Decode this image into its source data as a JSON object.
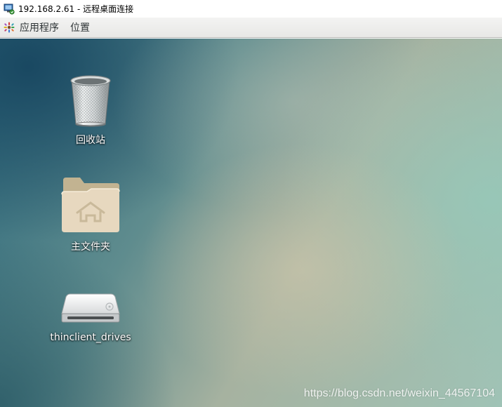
{
  "window": {
    "title": "192.168.2.61 - 远程桌面连接",
    "icon": "remote-desktop-icon"
  },
  "panel": {
    "applications_label": "应用程序",
    "places_label": "位置",
    "applications_icon": "gnome-foot-icon"
  },
  "desktop": {
    "icons": [
      {
        "label": "回收站",
        "icon": "trash-icon"
      },
      {
        "label": "主文件夹",
        "icon": "home-folder-icon"
      },
      {
        "label": "thinclient_drives",
        "icon": "drive-icon"
      }
    ]
  },
  "watermark": "https://blog.csdn.net/weixin_44567104",
  "colors": {
    "panel_bg": "#ececeb",
    "folder_tab": "#c2b391",
    "folder_body": "#e7d8bf"
  }
}
